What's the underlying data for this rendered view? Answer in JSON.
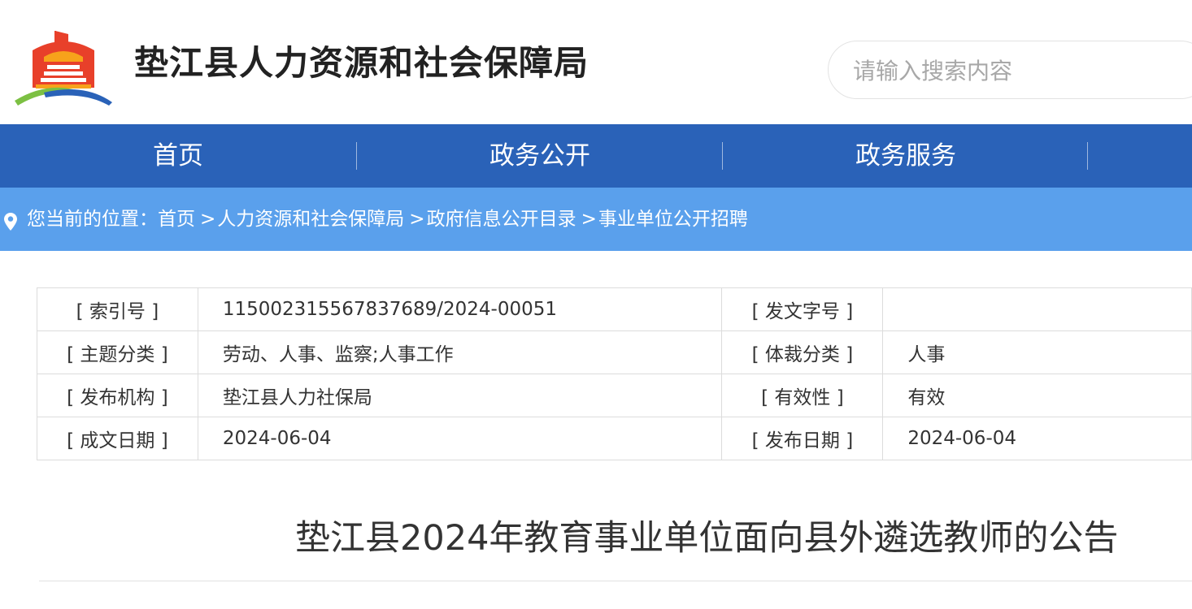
{
  "header": {
    "site_title": "垫江县人力资源和社会保障局",
    "search_placeholder": "请输入搜索内容"
  },
  "nav": {
    "items": [
      {
        "label": "首页"
      },
      {
        "label": "政务公开"
      },
      {
        "label": "政务服务"
      }
    ]
  },
  "breadcrumb": {
    "prefix": "您当前的位置：",
    "items": [
      "首页",
      "人力资源和社会保障局",
      "政府信息公开目录",
      "事业单位公开招聘"
    ],
    "separator": ">"
  },
  "meta": {
    "rows": [
      {
        "label1": "[ 索引号 ]",
        "value1": "11500231556783768 9/2024-00051",
        "label2": "[ 发文字号 ]",
        "value2": ""
      },
      {
        "label1": "[ 主题分类 ]",
        "value1": "劳动、人事、监察;人事工作",
        "label2": "[ 体裁分类 ]",
        "value2": "人事"
      },
      {
        "label1": "[ 发布机构 ]",
        "value1": "垫江县人力社保局",
        "label2": "[ 有效性 ]",
        "value2": "有效"
      },
      {
        "label1": "[ 成文日期 ]",
        "value1": "2024-06-04",
        "label2": "[ 发布日期 ]",
        "value2": "2024-06-04"
      }
    ]
  },
  "article": {
    "title": "垫江县2024年教育事业单位面向县外遴选教师的公告"
  },
  "colors": {
    "nav_bg": "#2a62b8",
    "breadcrumb_bg": "#5aa0ec"
  }
}
